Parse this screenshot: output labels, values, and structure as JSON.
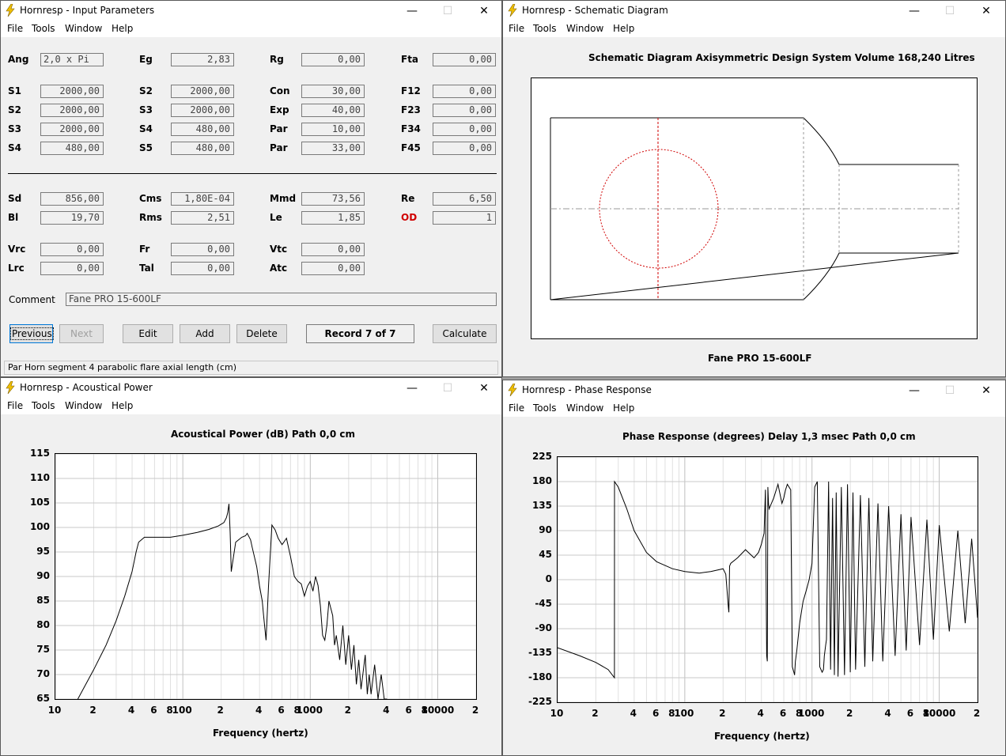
{
  "menu": {
    "file": "File",
    "tools": "Tools",
    "window": "Window",
    "help": "Help"
  },
  "titlebar_buttons": {
    "minimize": "—",
    "maximize": "☐",
    "close": "✕"
  },
  "input_window": {
    "title": "Hornresp - Input Parameters",
    "row1": [
      {
        "label": "Ang",
        "value": "2,0 x Pi"
      },
      {
        "label": "Eg",
        "value": "2,83"
      },
      {
        "label": "Rg",
        "value": "0,00"
      },
      {
        "label": "Fta",
        "value": "0,00"
      }
    ],
    "segments": [
      [
        {
          "label": "S1",
          "value": "2000,00"
        },
        {
          "label": "S2",
          "value": "2000,00"
        },
        {
          "label": "Con",
          "value": "30,00"
        },
        {
          "label": "F12",
          "value": "0,00"
        }
      ],
      [
        {
          "label": "S2",
          "value": "2000,00"
        },
        {
          "label": "S3",
          "value": "2000,00"
        },
        {
          "label": "Exp",
          "value": "40,00"
        },
        {
          "label": "F23",
          "value": "0,00"
        }
      ],
      [
        {
          "label": "S3",
          "value": "2000,00"
        },
        {
          "label": "S4",
          "value": "480,00"
        },
        {
          "label": "Par",
          "value": "10,00"
        },
        {
          "label": "F34",
          "value": "0,00"
        }
      ],
      [
        {
          "label": "S4",
          "value": "480,00"
        },
        {
          "label": "S5",
          "value": "480,00"
        },
        {
          "label": "Par",
          "value": "33,00"
        },
        {
          "label": "F45",
          "value": "0,00"
        }
      ]
    ],
    "driver": [
      [
        {
          "label": "Sd",
          "value": "856,00"
        },
        {
          "label": "Cms",
          "value": "1,80E-04"
        },
        {
          "label": "Mmd",
          "value": "73,56"
        },
        {
          "label": "Re",
          "value": "6,50"
        }
      ],
      [
        {
          "label": "Bl",
          "value": "19,70"
        },
        {
          "label": "Rms",
          "value": "2,51"
        },
        {
          "label": "Le",
          "value": "1,85"
        },
        {
          "label": "OD",
          "value": "1",
          "color": "#d00000"
        }
      ]
    ],
    "chambers": [
      [
        {
          "label": "Vrc",
          "value": "0,00"
        },
        {
          "label": "Fr",
          "value": "0,00"
        },
        {
          "label": "Vtc",
          "value": "0,00"
        }
      ],
      [
        {
          "label": "Lrc",
          "value": "0,00"
        },
        {
          "label": "Tal",
          "value": "0,00"
        },
        {
          "label": "Atc",
          "value": "0,00"
        }
      ]
    ],
    "comment_label": "Comment",
    "comment_value": "Fane PRO 15-600LF",
    "buttons": {
      "previous": "Previous",
      "next": "Next",
      "edit": "Edit",
      "add": "Add",
      "delete": "Delete",
      "record": "Record 7 of 7",
      "calculate": "Calculate"
    },
    "status": "Par   Horn segment 4 parabolic flare axial length  (cm)"
  },
  "schematic_window": {
    "title": "Hornresp - Schematic Diagram",
    "heading": "Schematic Diagram   Axisymmetric Design   System Volume 168,240 Litres",
    "caption": "Fane PRO 15-600LF"
  },
  "power_window": {
    "title": "Hornresp - Acoustical Power",
    "chart_data": {
      "type": "line",
      "title": "Acoustical Power (dB)   Path 0,0 cm",
      "xlabel": "Frequency (hertz)",
      "ylabel": "",
      "xscale": "log",
      "xlim": [
        10,
        20000
      ],
      "ylim": [
        65,
        115
      ],
      "grid": true,
      "yticks": [
        "115",
        "110",
        "105",
        "100",
        "95",
        "90",
        "85",
        "80",
        "75",
        "70",
        "65"
      ],
      "xticks": [
        "10",
        "2",
        "4",
        "6",
        "8",
        "100",
        "2",
        "4",
        "6",
        "8",
        "1000",
        "2",
        "4",
        "6",
        "8",
        "10000",
        "2"
      ],
      "x": [
        15,
        20,
        25,
        30,
        35,
        40,
        43,
        45,
        50,
        60,
        80,
        100,
        130,
        160,
        190,
        210,
        220,
        225,
        230,
        235,
        240,
        260,
        290,
        310,
        320,
        340,
        350,
        380,
        390,
        400,
        420,
        430,
        450,
        470,
        500,
        530,
        560,
        600,
        620,
        650,
        700,
        750,
        800,
        850,
        900,
        950,
        1000,
        1050,
        1100,
        1150,
        1200,
        1250,
        1300,
        1350,
        1400,
        1500,
        1550,
        1600,
        1700,
        1800,
        1900,
        2000,
        2100,
        2200,
        2300,
        2400,
        2500,
        2700,
        2800,
        2900,
        3000,
        3200,
        3400,
        3600,
        3800,
        4000
      ],
      "y": [
        65,
        71,
        76,
        81,
        86,
        91,
        95,
        97,
        98,
        98,
        98,
        98.4,
        99,
        99.6,
        100.3,
        101,
        102,
        103,
        104.8,
        99,
        91,
        97,
        98,
        98.3,
        98.8,
        97.5,
        96,
        92,
        90,
        88,
        85,
        82,
        77,
        88,
        100.5,
        99.5,
        97.8,
        96.5,
        97,
        97.8,
        94,
        90,
        89,
        88.5,
        86,
        88,
        89,
        87,
        90,
        88.2,
        84,
        78,
        77,
        80,
        85,
        82,
        76,
        78,
        73,
        80,
        72,
        78,
        71,
        76,
        68,
        73,
        67,
        74,
        66,
        70,
        66,
        72,
        65,
        70,
        65,
        65
      ]
    }
  },
  "phase_window": {
    "title": "Hornresp - Phase Response",
    "chart_data": {
      "type": "line",
      "title": "Phase Response (degrees)   Delay 1,3 msec   Path 0,0 cm",
      "xlabel": "Frequency (hertz)",
      "ylabel": "",
      "xscale": "log",
      "xlim": [
        10,
        20000
      ],
      "ylim": [
        -225,
        225
      ],
      "grid": true,
      "yticks": [
        "225",
        "180",
        "135",
        "90",
        "45",
        "0",
        "-45",
        "-90",
        "-135",
        "-180",
        "-225"
      ],
      "xticks": [
        "10",
        "2",
        "4",
        "6",
        "8",
        "100",
        "2",
        "4",
        "6",
        "8",
        "1000",
        "2",
        "4",
        "6",
        "8",
        "10000",
        "2"
      ],
      "x": [
        10,
        15,
        20,
        25,
        28,
        28.01,
        30,
        35,
        40,
        50,
        60,
        80,
        100,
        130,
        160,
        200,
        210,
        220,
        222,
        225,
        230,
        260,
        300,
        350,
        380,
        400,
        420,
        430,
        440,
        445,
        450,
        455,
        460,
        480,
        500,
        540,
        580,
        600,
        620,
        640,
        680,
        700,
        720,
        730,
        740,
        760,
        800,
        850,
        900,
        950,
        1000,
        1050,
        1100,
        1150,
        1200,
        1230,
        1250,
        1280,
        1300,
        1350,
        1400,
        1450,
        1500,
        1550,
        1600,
        1700,
        1800,
        1900,
        2000,
        2100,
        2200,
        2400,
        2600,
        2800,
        3000,
        3300,
        3600,
        4000,
        4500,
        5000,
        5500,
        6000,
        7000,
        8000,
        9000,
        10000,
        12000,
        14000,
        16000,
        18000,
        20000
      ],
      "y": [
        -125,
        -140,
        -152,
        -165,
        -180,
        180,
        170,
        130,
        90,
        50,
        33,
        20,
        15,
        12,
        15,
        20,
        10,
        -50,
        -60,
        25,
        30,
        40,
        55,
        40,
        50,
        65,
        85,
        165,
        -140,
        -150,
        170,
        140,
        130,
        140,
        150,
        175,
        140,
        150,
        165,
        175,
        165,
        -160,
        -170,
        -175,
        -150,
        -130,
        -80,
        -40,
        -20,
        0,
        30,
        170,
        180,
        -160,
        -170,
        -165,
        -140,
        -120,
        -110,
        180,
        -165,
        150,
        -175,
        160,
        -178,
        170,
        -175,
        175,
        -170,
        160,
        -165,
        155,
        -160,
        150,
        -150,
        140,
        -150,
        135,
        -140,
        120,
        -130,
        115,
        -120,
        110,
        -110,
        100,
        -95,
        90,
        -80,
        75,
        -70
      ]
    }
  }
}
